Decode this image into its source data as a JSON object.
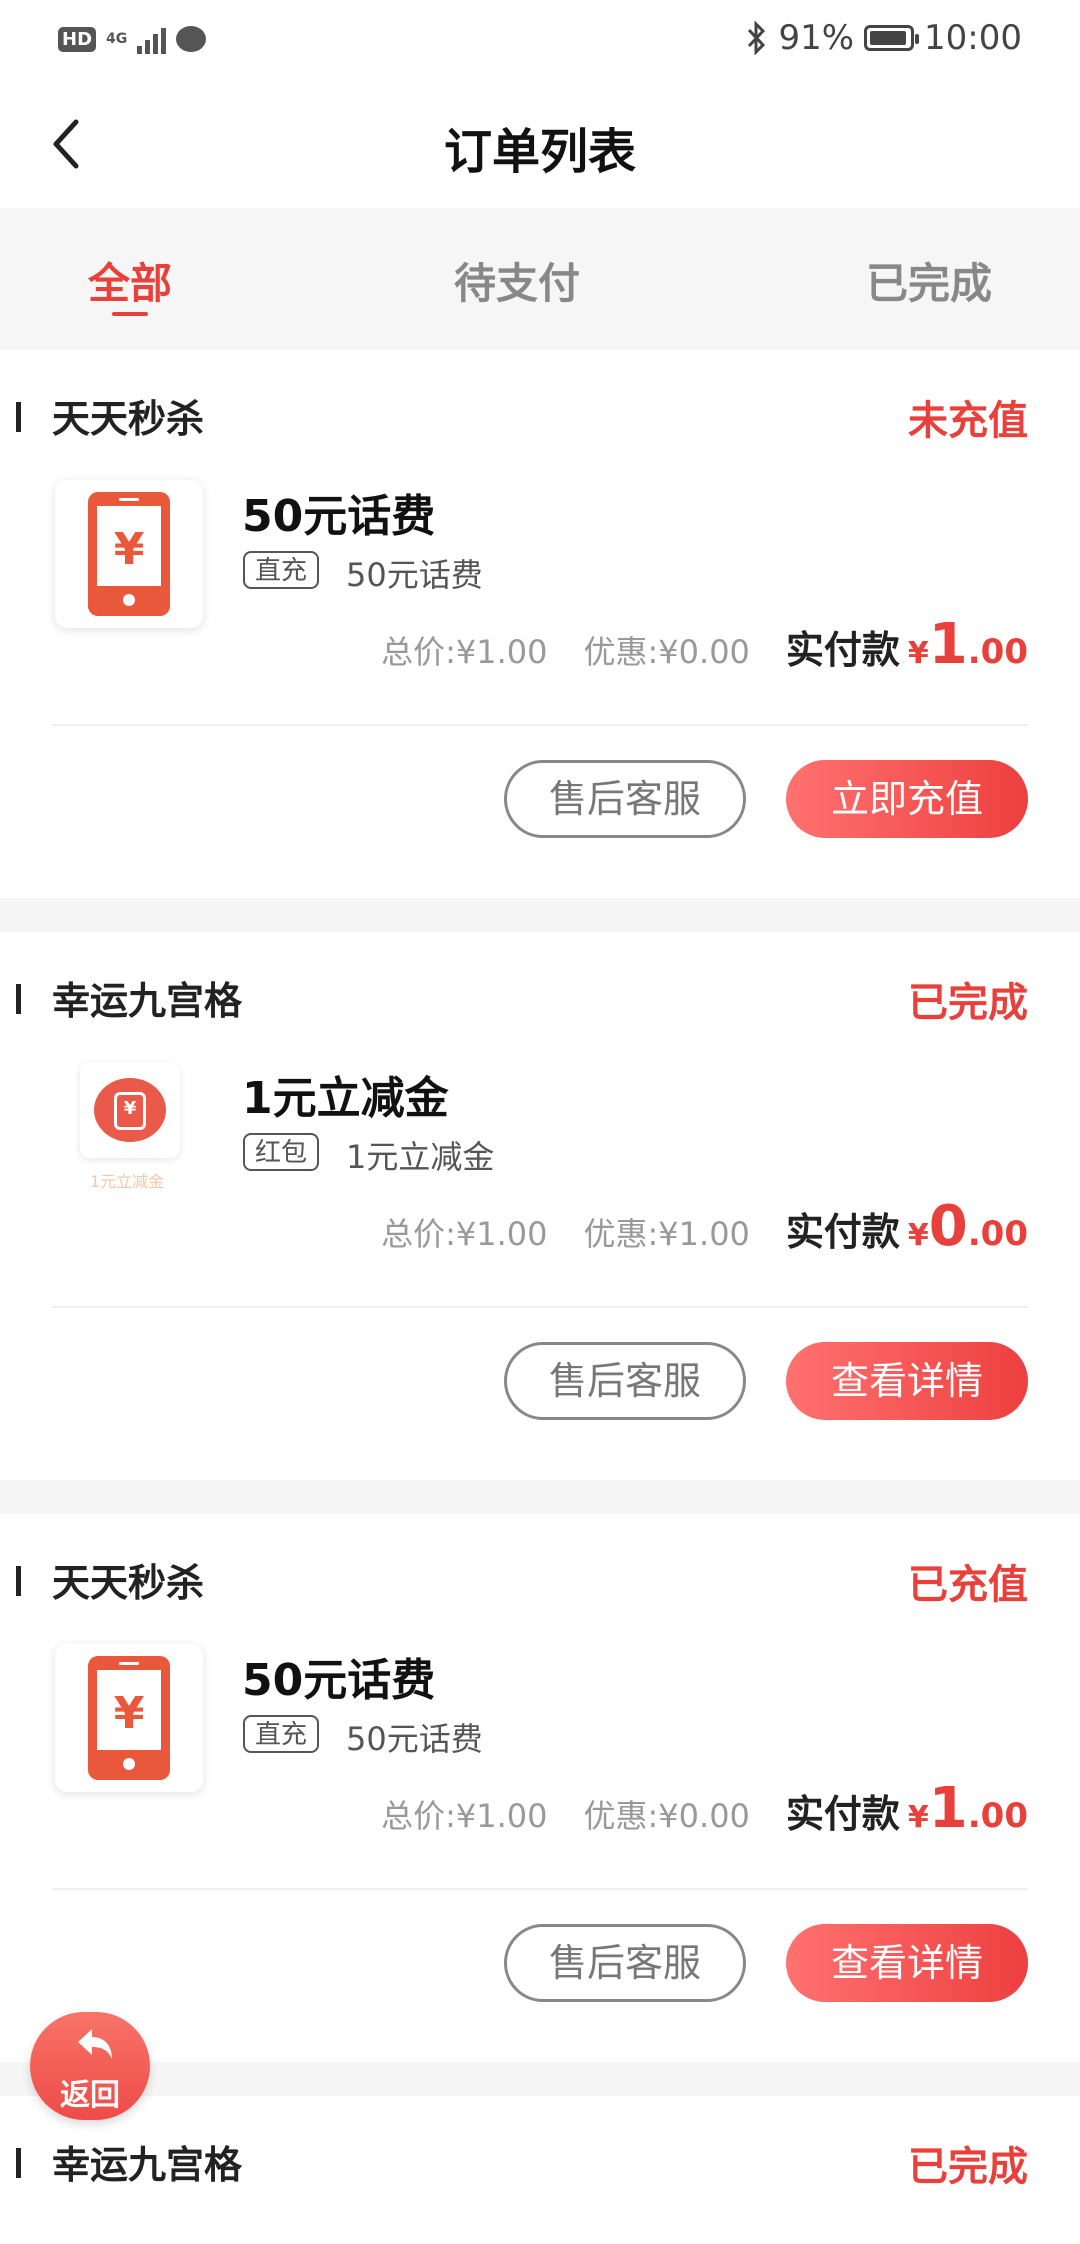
{
  "status_bar": {
    "network_hd": "HD",
    "network_4g": "4G",
    "battery_percent": "91%",
    "time": "10:00"
  },
  "header": {
    "title": "订单列表"
  },
  "tabs": [
    {
      "label": "全部",
      "active": true
    },
    {
      "label": "待支付",
      "active": false
    },
    {
      "label": "已完成",
      "active": false
    }
  ],
  "orders": [
    {
      "shop": "天天秒杀",
      "status": "未充值",
      "title": "50元话费",
      "tag": "直充",
      "subtitle": "50元话费",
      "total_label": "总价:",
      "total": "¥1.00",
      "discount_label": "优惠:",
      "discount": "¥0.00",
      "pay_label": "实付款",
      "pay_yen": "¥",
      "pay_int": "1",
      "pay_dec": ".00",
      "btn_service": "售后客服",
      "btn_action": "立即充值"
    },
    {
      "shop": "幸运九宫格",
      "status": "已完成",
      "title": "1元立减金",
      "tag": "红包",
      "subtitle": "1元立减金",
      "thumb_caption": "1元立减金",
      "total_label": "总价:",
      "total": "¥1.00",
      "discount_label": "优惠:",
      "discount": "¥1.00",
      "pay_label": "实付款",
      "pay_yen": "¥",
      "pay_int": "0",
      "pay_dec": ".00",
      "btn_service": "售后客服",
      "btn_action": "查看详情"
    },
    {
      "shop": "天天秒杀",
      "status": "已充值",
      "title": "50元话费",
      "tag": "直充",
      "subtitle": "50元话费",
      "total_label": "总价:",
      "total": "¥1.00",
      "discount_label": "优惠:",
      "discount": "¥0.00",
      "pay_label": "实付款",
      "pay_yen": "¥",
      "pay_int": "1",
      "pay_dec": ".00",
      "btn_service": "售后客服",
      "btn_action": "查看详情"
    },
    {
      "shop": "幸运九宫格",
      "status": "已完成"
    }
  ],
  "float_button": {
    "label": "返回"
  },
  "colors": {
    "accent": "#e8413b",
    "phone_icon": "#e9583a"
  }
}
